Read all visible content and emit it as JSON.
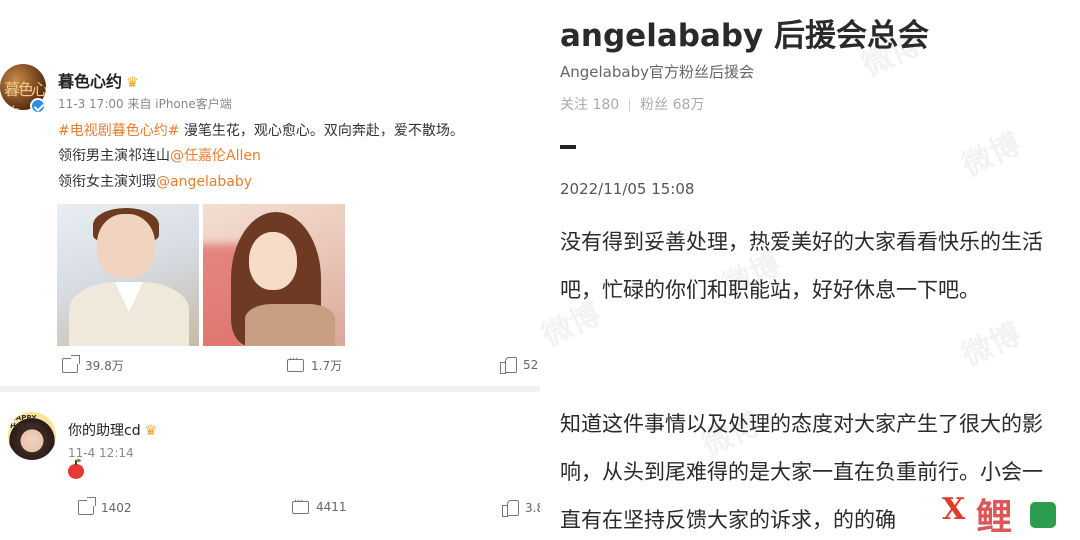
{
  "left": {
    "post": {
      "author": "暮色心约",
      "avatar_text": "暮色心约",
      "meta": "11-3 17:00  来自 iPhone客户端",
      "line1_hashtag": "#电视剧暮色心约#",
      "line1_rest": " 漫笔生花，观心愈心。双向奔赴，爱不散场。",
      "line2_prefix": "领衔男主演祁连山",
      "line2_mention": "@任嘉伦Allen",
      "line3_prefix": "领衔女主演刘瑕",
      "line3_mention": "@angelababy",
      "share_count": "39.8万",
      "comment_count": "1.7万",
      "like_count": "52"
    },
    "comment": {
      "author": "你的助理cd",
      "avatar_text": "HAPPY HOLIDA",
      "meta": "11-4 12:14",
      "share_count": "1402",
      "comment_count": "4411",
      "like_count": "3.8"
    }
  },
  "right": {
    "title": "angelababy 后援会总会",
    "subtitle": "Angelababy官方粉丝后援会",
    "follow": "关注 180",
    "fans": "粉丝 68万",
    "date": "2022/11/05 15:08",
    "para1": "没有得到妥善处理，热爱美好的大家看看快乐的生活吧，忙碌的你们和职能站，好好休息一下吧。",
    "para2": "知道这件事情以及处理的态度对大家产生了很大的影响，从头到尾难得的是大家一直在负重前行。小会一直有在坚持反馈大家的诉求，的的确",
    "watermark": "微博"
  },
  "logo": {
    "mark": "X",
    "text": "鲤"
  },
  "colors": {
    "accent_orange": "#e97d30",
    "verified_blue": "#2a8de6",
    "logo_red": "#e23b2e",
    "logo_green": "#2c9d4d"
  }
}
